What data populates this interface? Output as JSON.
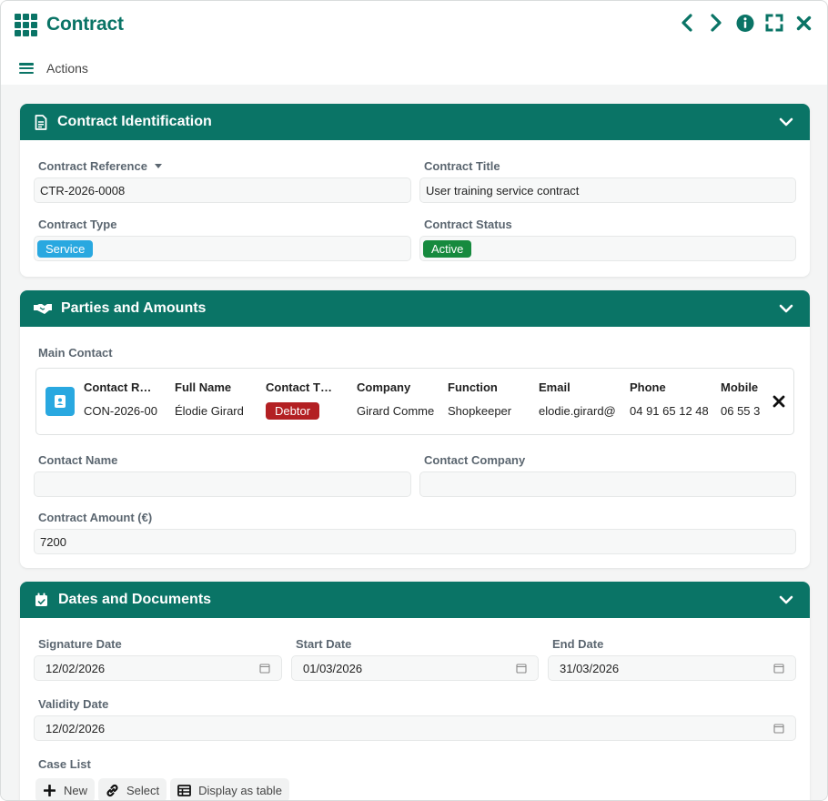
{
  "window": {
    "title": "Contract",
    "actions_label": "Actions"
  },
  "colors": {
    "accent": "#0a7466",
    "service": "#29a8e0",
    "active": "#168a3e",
    "debtor": "#b32023"
  },
  "sections": {
    "identification": {
      "title": "Contract Identification",
      "reference_label": "Contract Reference",
      "reference_value": "CTR-2026-0008",
      "title_label": "Contract Title",
      "title_value": "User training service contract",
      "type_label": "Contract Type",
      "type_value": "Service",
      "status_label": "Contract Status",
      "status_value": "Active"
    },
    "parties": {
      "title": "Parties and Amounts",
      "main_contact_label": "Main Contact",
      "contact": {
        "columns": [
          {
            "header": "Contact R…",
            "value": "CON-2026-00"
          },
          {
            "header": "Full Name",
            "value": "Élodie Girard"
          },
          {
            "header": "Contact T…",
            "value": "Debtor"
          },
          {
            "header": "Company",
            "value": "Girard Comme"
          },
          {
            "header": "Function",
            "value": "Shopkeeper"
          },
          {
            "header": "Email",
            "value": "elodie.girard@"
          },
          {
            "header": "Phone",
            "value": "04 91 65 12 48"
          },
          {
            "header": "Mobile",
            "value": "06 55 3"
          }
        ]
      },
      "contact_name_label": "Contact Name",
      "contact_name_value": "",
      "contact_company_label": "Contact Company",
      "contact_company_value": "",
      "amount_label": "Contract Amount (€)",
      "amount_value": "7200"
    },
    "dates": {
      "title": "Dates and Documents",
      "signature_label": "Signature Date",
      "signature_value": "12/02/2026",
      "start_label": "Start Date",
      "start_value": "01/03/2026",
      "end_label": "End Date",
      "end_value": "31/03/2026",
      "validity_label": "Validity Date",
      "validity_value": "12/02/2026",
      "case_list_label": "Case List",
      "buttons": {
        "new": "New",
        "select": "Select",
        "table": "Display as table"
      }
    }
  }
}
